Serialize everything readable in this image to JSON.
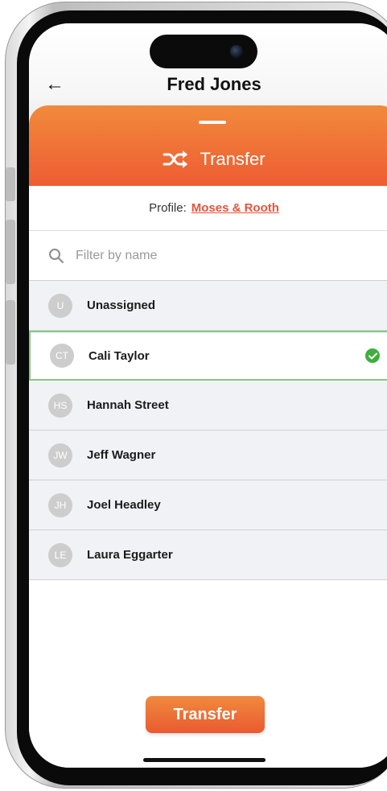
{
  "header": {
    "back_icon": "arrow-left-icon",
    "title": "Fred Jones"
  },
  "sheet": {
    "icon": "shuffle-icon",
    "title": "Transfer",
    "accent_color": "#ee5c33"
  },
  "profile": {
    "label": "Profile:",
    "value": "Moses & Rooth"
  },
  "search": {
    "icon": "search-icon",
    "placeholder": "Filter by name",
    "value": ""
  },
  "users": [
    {
      "initials": "U",
      "name": "Unassigned",
      "selected": false
    },
    {
      "initials": "CT",
      "name": "Cali Taylor",
      "selected": true
    },
    {
      "initials": "HS",
      "name": "Hannah Street",
      "selected": false
    },
    {
      "initials": "JW",
      "name": "Jeff Wagner",
      "selected": false
    },
    {
      "initials": "JH",
      "name": "Joel Headley",
      "selected": false
    },
    {
      "initials": "LE",
      "name": "Laura Eggarter",
      "selected": false
    }
  ],
  "selected_icon": "check-circle-icon",
  "footer": {
    "transfer_label": "Transfer"
  }
}
